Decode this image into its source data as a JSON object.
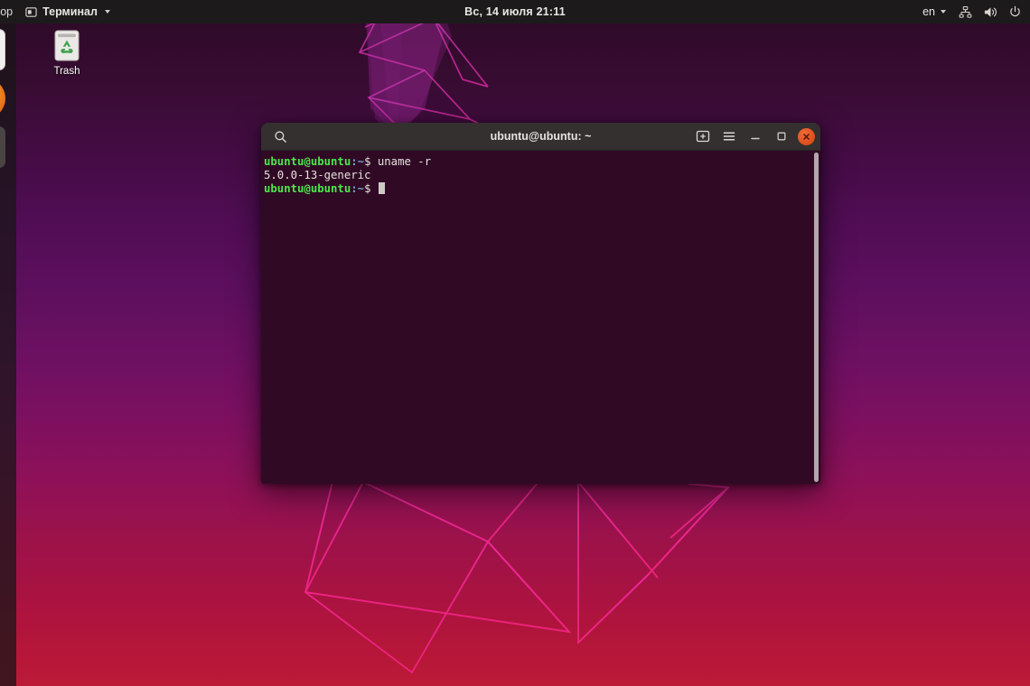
{
  "topbar": {
    "activities": "Обзор",
    "app_icon": "window-icon",
    "app_name": "Терминал",
    "app_caret": "chevron-down-icon",
    "clock": "Вс, 14 июля  21:11",
    "keyboard_layout": "en",
    "keyboard_caret": "chevron-down-icon",
    "network_icon": "network-wired-icon",
    "volume_icon": "volume-high-icon",
    "power_icon": "power-icon",
    "background": "#1d1a1b"
  },
  "dock": {
    "items": [
      {
        "name": "files-icon",
        "label": "Files",
        "color": "#f2f1ef"
      },
      {
        "name": "firefox-icon",
        "label": "Firefox",
        "color": "#e8701a"
      },
      {
        "name": "app-icon",
        "label": "Application",
        "color": "#4a4544"
      }
    ],
    "show_apps": "show-applications-icon"
  },
  "desktop": {
    "trash": {
      "label": "Trash",
      "icon": "trash-recycle-icon"
    }
  },
  "terminal": {
    "title": "ubuntu@ubuntu: ~",
    "search_icon": "search-icon",
    "new_tab_icon": "new-tab-icon",
    "menu_icon": "hamburger-menu-icon",
    "minimize_icon": "minimize-icon",
    "maximize_icon": "maximize-icon",
    "close_icon": "close-icon",
    "titlebar_color": "#33302f",
    "body_color": "#300a24",
    "close_color": "#e2521f",
    "lines": [
      {
        "segments": [
          {
            "text": "ubuntu@ubuntu",
            "style": "green"
          },
          {
            "text": ":~",
            "style": "blue"
          },
          {
            "text": "$ uname -r",
            "style": "white"
          }
        ]
      },
      {
        "segments": [
          {
            "text": "5.0.0-13-generic",
            "style": "white"
          }
        ]
      },
      {
        "segments": [
          {
            "text": "ubuntu@ubuntu",
            "style": "green"
          },
          {
            "text": ":~",
            "style": "blue"
          },
          {
            "text": "$ ",
            "style": "white"
          }
        ],
        "cursor": true
      }
    ]
  },
  "wallpaper": {
    "top_color": "#2b0a25",
    "bottom_color": "#bc1a37",
    "line_color": "#e8218f"
  }
}
